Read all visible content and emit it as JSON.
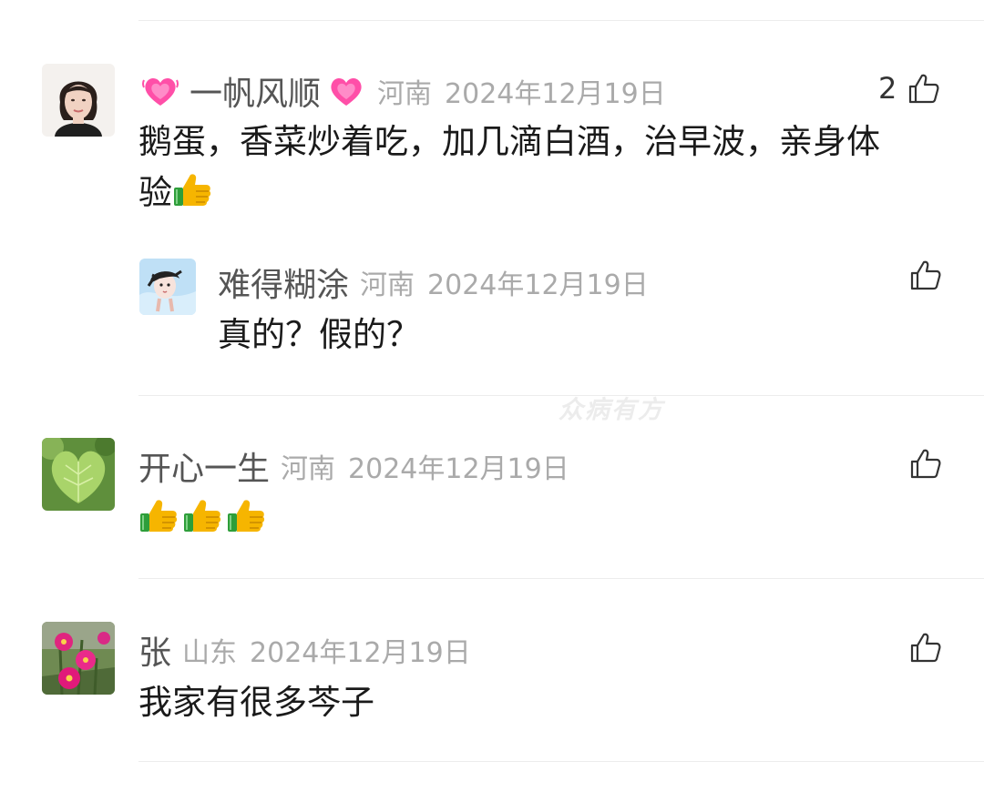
{
  "watermark": "众病有方",
  "comments": [
    {
      "name": "一帆风顺",
      "location": "河南",
      "date": "2024年12月19日",
      "likes": "2",
      "text_line1": "鹅蛋，香菜炒着吃，加几滴白酒，治早波，亲身体",
      "text_line2": "验",
      "replies": [
        {
          "name": "难得糊涂",
          "location": "河南",
          "date": "2024年12月19日",
          "text": "真的？假的？"
        }
      ]
    },
    {
      "name": "开心一生",
      "location": "河南",
      "date": "2024年12月19日",
      "text": ""
    },
    {
      "name": "张",
      "location": "山东",
      "date": "2024年12月19日",
      "text": "我家有很多芩子"
    }
  ],
  "icons": {
    "like": "thumbs-up-outline-icon",
    "heart": "heart-icon",
    "thumbs_emoji": "thumbs-up-emoji"
  },
  "colors": {
    "meta_text": "#aaaaaa",
    "nickname": "#555555",
    "heart": "#ff4fa8",
    "thumb": "#f6b500"
  }
}
